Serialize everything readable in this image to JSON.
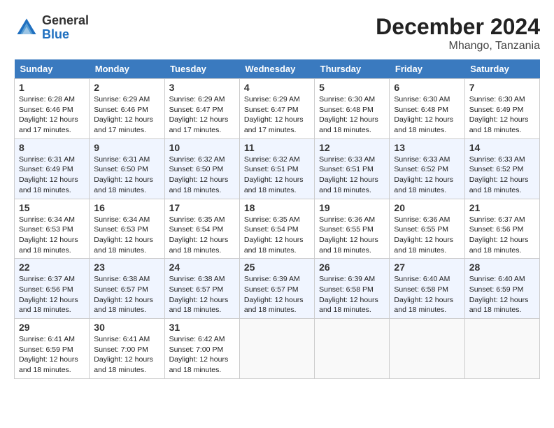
{
  "header": {
    "logo_general": "General",
    "logo_blue": "Blue",
    "month_title": "December 2024",
    "location": "Mhango, Tanzania"
  },
  "days_of_week": [
    "Sunday",
    "Monday",
    "Tuesday",
    "Wednesday",
    "Thursday",
    "Friday",
    "Saturday"
  ],
  "weeks": [
    [
      {
        "day": 1,
        "sunrise": "6:28 AM",
        "sunset": "6:46 PM",
        "daylight": "12 hours and 17 minutes."
      },
      {
        "day": 2,
        "sunrise": "6:29 AM",
        "sunset": "6:46 PM",
        "daylight": "12 hours and 17 minutes."
      },
      {
        "day": 3,
        "sunrise": "6:29 AM",
        "sunset": "6:47 PM",
        "daylight": "12 hours and 17 minutes."
      },
      {
        "day": 4,
        "sunrise": "6:29 AM",
        "sunset": "6:47 PM",
        "daylight": "12 hours and 17 minutes."
      },
      {
        "day": 5,
        "sunrise": "6:30 AM",
        "sunset": "6:48 PM",
        "daylight": "12 hours and 18 minutes."
      },
      {
        "day": 6,
        "sunrise": "6:30 AM",
        "sunset": "6:48 PM",
        "daylight": "12 hours and 18 minutes."
      },
      {
        "day": 7,
        "sunrise": "6:30 AM",
        "sunset": "6:49 PM",
        "daylight": "12 hours and 18 minutes."
      }
    ],
    [
      {
        "day": 8,
        "sunrise": "6:31 AM",
        "sunset": "6:49 PM",
        "daylight": "12 hours and 18 minutes."
      },
      {
        "day": 9,
        "sunrise": "6:31 AM",
        "sunset": "6:50 PM",
        "daylight": "12 hours and 18 minutes."
      },
      {
        "day": 10,
        "sunrise": "6:32 AM",
        "sunset": "6:50 PM",
        "daylight": "12 hours and 18 minutes."
      },
      {
        "day": 11,
        "sunrise": "6:32 AM",
        "sunset": "6:51 PM",
        "daylight": "12 hours and 18 minutes."
      },
      {
        "day": 12,
        "sunrise": "6:33 AM",
        "sunset": "6:51 PM",
        "daylight": "12 hours and 18 minutes."
      },
      {
        "day": 13,
        "sunrise": "6:33 AM",
        "sunset": "6:52 PM",
        "daylight": "12 hours and 18 minutes."
      },
      {
        "day": 14,
        "sunrise": "6:33 AM",
        "sunset": "6:52 PM",
        "daylight": "12 hours and 18 minutes."
      }
    ],
    [
      {
        "day": 15,
        "sunrise": "6:34 AM",
        "sunset": "6:53 PM",
        "daylight": "12 hours and 18 minutes."
      },
      {
        "day": 16,
        "sunrise": "6:34 AM",
        "sunset": "6:53 PM",
        "daylight": "12 hours and 18 minutes."
      },
      {
        "day": 17,
        "sunrise": "6:35 AM",
        "sunset": "6:54 PM",
        "daylight": "12 hours and 18 minutes."
      },
      {
        "day": 18,
        "sunrise": "6:35 AM",
        "sunset": "6:54 PM",
        "daylight": "12 hours and 18 minutes."
      },
      {
        "day": 19,
        "sunrise": "6:36 AM",
        "sunset": "6:55 PM",
        "daylight": "12 hours and 18 minutes."
      },
      {
        "day": 20,
        "sunrise": "6:36 AM",
        "sunset": "6:55 PM",
        "daylight": "12 hours and 18 minutes."
      },
      {
        "day": 21,
        "sunrise": "6:37 AM",
        "sunset": "6:56 PM",
        "daylight": "12 hours and 18 minutes."
      }
    ],
    [
      {
        "day": 22,
        "sunrise": "6:37 AM",
        "sunset": "6:56 PM",
        "daylight": "12 hours and 18 minutes."
      },
      {
        "day": 23,
        "sunrise": "6:38 AM",
        "sunset": "6:57 PM",
        "daylight": "12 hours and 18 minutes."
      },
      {
        "day": 24,
        "sunrise": "6:38 AM",
        "sunset": "6:57 PM",
        "daylight": "12 hours and 18 minutes."
      },
      {
        "day": 25,
        "sunrise": "6:39 AM",
        "sunset": "6:57 PM",
        "daylight": "12 hours and 18 minutes."
      },
      {
        "day": 26,
        "sunrise": "6:39 AM",
        "sunset": "6:58 PM",
        "daylight": "12 hours and 18 minutes."
      },
      {
        "day": 27,
        "sunrise": "6:40 AM",
        "sunset": "6:58 PM",
        "daylight": "12 hours and 18 minutes."
      },
      {
        "day": 28,
        "sunrise": "6:40 AM",
        "sunset": "6:59 PM",
        "daylight": "12 hours and 18 minutes."
      }
    ],
    [
      {
        "day": 29,
        "sunrise": "6:41 AM",
        "sunset": "6:59 PM",
        "daylight": "12 hours and 18 minutes."
      },
      {
        "day": 30,
        "sunrise": "6:41 AM",
        "sunset": "7:00 PM",
        "daylight": "12 hours and 18 minutes."
      },
      {
        "day": 31,
        "sunrise": "6:42 AM",
        "sunset": "7:00 PM",
        "daylight": "12 hours and 18 minutes."
      },
      null,
      null,
      null,
      null
    ]
  ]
}
